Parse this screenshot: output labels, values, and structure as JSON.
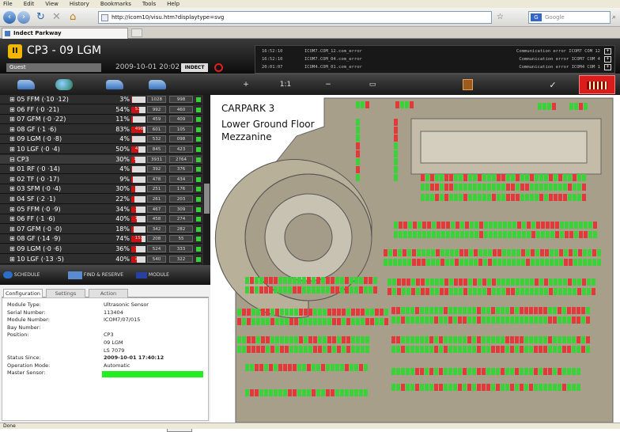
{
  "browser": {
    "menu": [
      "File",
      "Edit",
      "View",
      "History",
      "Bookmarks",
      "Tools",
      "Help"
    ],
    "url": "http://icom10/visu.htm?displaytype=svg",
    "search_placeholder": "Google",
    "tab_title": "Indect Parkway",
    "status": "Done"
  },
  "header": {
    "title": "CP3 - 09 LGM",
    "user": "Guest",
    "datetime": "2009-10-01 20:02",
    "brand": "INDECT",
    "events": [
      {
        "time": "16:52:10",
        "name": "ICOM7.COM_12.com_error",
        "message": "Communication error ICOM7 COM 12",
        "icon": "+"
      },
      {
        "time": "16:52:10",
        "name": "ICOM7.COM_04.com_error",
        "message": "Communication error ICOM7 COM 4",
        "icon": "+"
      },
      {
        "time": "20:01:07",
        "name": "ICOM4.COM_01.com_error",
        "message": "Communication error ICOM4 COM 1",
        "icon": "+"
      }
    ]
  },
  "toolbar": {
    "zoom_in": "+",
    "zoom_reset": "1:1",
    "zoom_out": "−",
    "zoom_fit": "▭",
    "alarm_active": true
  },
  "tree": {
    "rows": [
      {
        "name": "⊞ 05 FFM (·10 ·12)",
        "pct": "3%",
        "occ": 0.03,
        "n1": "30",
        "n2": "1028",
        "n3": "998"
      },
      {
        "name": "⊞ 06 FF (·0 ·21)",
        "pct": "54%",
        "occ": 0.54,
        "n1": "532",
        "n2": "992",
        "n3": "460"
      },
      {
        "name": "⊞ 07 GFM (·0 ·22)",
        "pct": "11%",
        "occ": 0.11,
        "n1": "50",
        "n2": "459",
        "n3": "409"
      },
      {
        "name": "⊞ 08 GF (·1 ·6)",
        "pct": "83%",
        "occ": 0.83,
        "n1": "498",
        "n2": "601",
        "n3": "105"
      },
      {
        "name": "⊞ 09 LGM (·0 ·8)",
        "pct": "4%",
        "occ": 0.04,
        "n1": "24",
        "n2": "532",
        "n3": "098"
      },
      {
        "name": "⊞ 10 LGF (·0 ·4)",
        "pct": "50%",
        "occ": 0.5,
        "n1": "422",
        "n2": "845",
        "n3": "423"
      },
      {
        "name": "⊟ CP3",
        "pct": "30%",
        "occ": 0.3,
        "n1": "1167",
        "n2": "3931",
        "n3": "2764"
      },
      {
        "name": "⊞ 01 RF (·0 ·14)",
        "pct": "4%",
        "occ": 0.04,
        "n1": "16",
        "n2": "392",
        "n3": "376"
      },
      {
        "name": "⊞ 02 TF (·0 ·17)",
        "pct": "9%",
        "occ": 0.09,
        "n1": "44",
        "n2": "478",
        "n3": "434"
      },
      {
        "name": "⊞ 03 SFM (·0 ·4)",
        "pct": "30%",
        "occ": 0.3,
        "n1": "75",
        "n2": "251",
        "n3": "176"
      },
      {
        "name": "⊞ 04 SF (·2 ·1)",
        "pct": "22%",
        "occ": 0.22,
        "n1": "58",
        "n2": "261",
        "n3": "203"
      },
      {
        "name": "⊞ 05 FFM (·0 ·9)",
        "pct": "34%",
        "occ": 0.34,
        "n1": "158",
        "n2": "467",
        "n3": "309"
      },
      {
        "name": "⊞ 06 FF (·1 ·6)",
        "pct": "40%",
        "occ": 0.4,
        "n1": "184",
        "n2": "458",
        "n3": "274"
      },
      {
        "name": "⊞ 07 GFM (·0 ·0)",
        "pct": "18%",
        "occ": 0.18,
        "n1": "60",
        "n2": "342",
        "n3": "282"
      },
      {
        "name": "⊞ 08 GF (·14 ·9)",
        "pct": "74%",
        "occ": 0.74,
        "n1": "153",
        "n2": "208",
        "n3": "55"
      },
      {
        "name": "⊞ 09 LGM (·0 ·6)",
        "pct": "36%",
        "occ": 0.36,
        "n1": "191",
        "n2": "524",
        "n3": "333"
      },
      {
        "name": "⊞ 10 LGF (·13 ·5)",
        "pct": "40%",
        "occ": 0.4,
        "n1": "218",
        "n2": "540",
        "n3": "322"
      }
    ]
  },
  "buttons": {
    "schedule": "SCHEDULE",
    "find_reserve": "FIND & RESERVE",
    "module": "MODULE"
  },
  "details": {
    "tabs": [
      "Configuration",
      "Settings",
      "Action"
    ],
    "rows": [
      {
        "key": "Module Type:",
        "value": "Ultrasonic Sensor"
      },
      {
        "key": "Serial Number:",
        "value": "113404"
      },
      {
        "key": "Module Number:",
        "value": "ICOM7/07/015"
      },
      {
        "key": "Bay Number:",
        "value": ""
      },
      {
        "key": "Position:",
        "value": "CP3"
      },
      {
        "key": "",
        "value": "09 LGM"
      },
      {
        "key": "",
        "value": "LS 7079"
      },
      {
        "key": "Status Since:",
        "value": "2009-10-01 17:40:12"
      },
      {
        "key": "Operation Mode:",
        "value": "Automatic"
      },
      {
        "key": "Master Sensor:",
        "value": ""
      }
    ],
    "ok": "OK"
  },
  "map": {
    "line1": "CARPARK 3",
    "line2": "Lower Ground Floor",
    "line3": "Mezzanine"
  },
  "colors": {
    "occupied": "#e23a3a",
    "free": "#39d339",
    "accent": "#f2b705",
    "alarm": "#d91c1c"
  }
}
